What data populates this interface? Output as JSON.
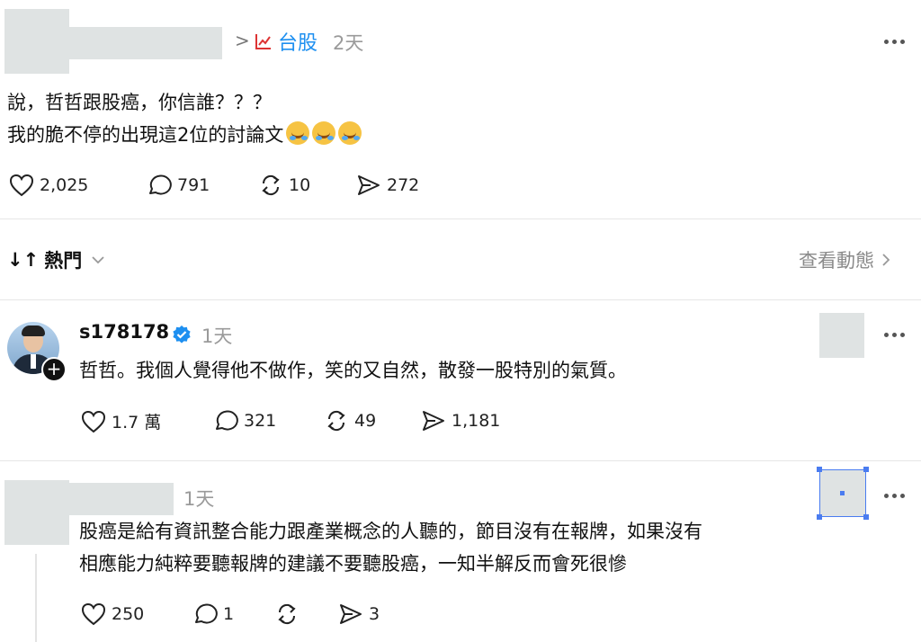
{
  "post": {
    "breadcrumb_separator": ">",
    "topic": "台股",
    "time": "2天",
    "lines": [
      "說，哲哲跟股癌，你信誰？？？",
      "我的脆不停的出現這2位的討論文"
    ],
    "emoji": "rolling-on-floor-laughing",
    "emoji_count": 3,
    "likes": "2,025",
    "replies": "791",
    "reposts": "10",
    "shares": "272"
  },
  "sort_bar": {
    "sort_icon": "↓↑",
    "sort_label": "熱門",
    "view_activity": "查看動態"
  },
  "comments": [
    {
      "username": "s178178",
      "verified": true,
      "time": "1天",
      "text": "哲哲。我個人覺得他不做作，笑的又自然，散發一股特別的氣質。",
      "likes": "1.7 萬",
      "replies": "321",
      "reposts": "49",
      "shares": "1,181"
    },
    {
      "username": "",
      "time": "1天",
      "lines": [
        "股癌是給有資訊整合能力跟產業概念的人聽的，節目沒有在報牌，如果沒有",
        "相應能力純粹要聽報牌的建議不要聽股癌，一知半解反而會死很慘"
      ],
      "likes": "250",
      "replies": "1",
      "reposts": "",
      "shares": "3"
    }
  ],
  "colors": {
    "topic": "#1d8ff0",
    "redaction": "#dfe3e3",
    "verified": "#1d8ff0",
    "selection": "#4a7cf0"
  }
}
